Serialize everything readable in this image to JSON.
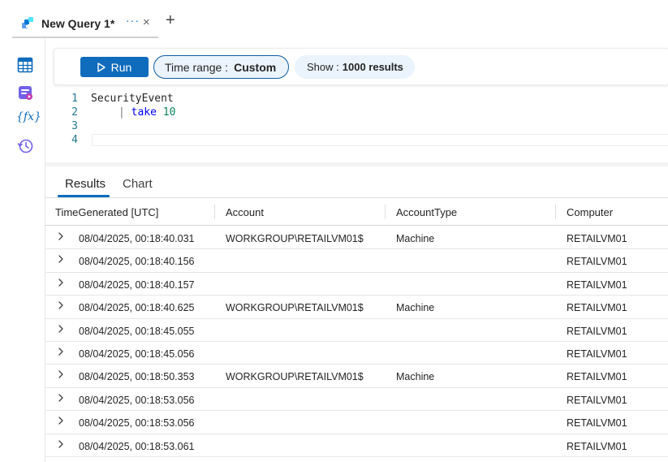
{
  "tab": {
    "title": "New Query 1*",
    "more_label": "···",
    "close_label": "×",
    "new_tab_label": "+"
  },
  "rail": {
    "icons": [
      "table-icon",
      "query-packs-icon",
      "functions-icon",
      "history-icon"
    ],
    "functions_glyph": "{fx}"
  },
  "toolbar": {
    "run_label": "Run",
    "time_range_label": "Time range :",
    "time_range_value": "Custom",
    "show_label": "Show :",
    "show_value": "1000 results"
  },
  "editor": {
    "line_numbers": [
      "1",
      "2",
      "3",
      "4"
    ],
    "line1": "SecurityEvent",
    "line2_pipe": "|",
    "line2_keyword": "take",
    "line2_number": "10",
    "line3": "",
    "line4": ""
  },
  "results": {
    "tabs": [
      {
        "label": "Results",
        "active": true
      },
      {
        "label": "Chart",
        "active": false
      }
    ],
    "columns": [
      "TimeGenerated [UTC]",
      "Account",
      "AccountType",
      "Computer"
    ],
    "rows": [
      [
        "08/04/2025, 00:18:40.031",
        "WORKGROUP\\RETAILVM01$",
        "Machine",
        "RETAILVM01"
      ],
      [
        "08/04/2025, 00:18:40.156",
        "",
        "",
        "RETAILVM01"
      ],
      [
        "08/04/2025, 00:18:40.157",
        "",
        "",
        "RETAILVM01"
      ],
      [
        "08/04/2025, 00:18:40.625",
        "WORKGROUP\\RETAILVM01$",
        "Machine",
        "RETAILVM01"
      ],
      [
        "08/04/2025, 00:18:45.055",
        "",
        "",
        "RETAILVM01"
      ],
      [
        "08/04/2025, 00:18:45.056",
        "",
        "",
        "RETAILVM01"
      ],
      [
        "08/04/2025, 00:18:50.353",
        "WORKGROUP\\RETAILVM01$",
        "Machine",
        "RETAILVM01"
      ],
      [
        "08/04/2025, 00:18:53.056",
        "",
        "",
        "RETAILVM01"
      ],
      [
        "08/04/2025, 00:18:53.056",
        "",
        "",
        "RETAILVM01"
      ],
      [
        "08/04/2025, 00:18:53.061",
        "",
        "",
        "RETAILVM01"
      ]
    ]
  },
  "colors": {
    "accent": "#0f6cbd",
    "pill_bg": "#ebf3fc",
    "line_number": "#237893",
    "keyword": "#0000ff",
    "number": "#098658"
  }
}
